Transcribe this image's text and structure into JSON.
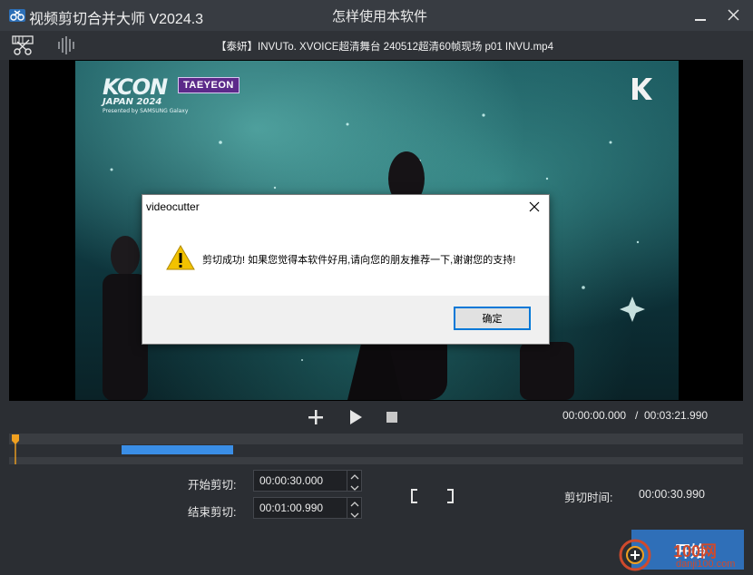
{
  "window": {
    "title": "视频剪切合并大师 V2024.3",
    "help_link": "怎样使用本软件"
  },
  "toolbar": {
    "file_name": "【泰妍】INVUTo. XVOICE超清舞台 240512超清60帧现场 p01 INVU.mp4",
    "icons": [
      "scissors-film-icon",
      "audio-wave-icon"
    ]
  },
  "video": {
    "overlay_logo": "KCON",
    "overlay_logo_sub": "JAPAN 2024",
    "overlay_logo_tiny": "Presented by SAMSUNG Galaxy",
    "overlay_artist": "TAEYEON"
  },
  "dialog": {
    "title": "videocutter",
    "message": "剪切成功! 如果您觉得本软件好用,请向您的朋友推荐一下,谢谢您的支持!",
    "ok_label": "确定"
  },
  "transport": {
    "current_time": "00:00:00.000",
    "separator": "/",
    "total_time": "00:03:21.990"
  },
  "timeline": {
    "playhead_fraction": 0.0,
    "selection_start_fraction": 0.1533,
    "selection_end_fraction": 0.3054
  },
  "cut": {
    "start_label": "开始剪切:",
    "start_value": "00:00:30.000",
    "end_label": "结束剪切:",
    "end_value": "00:01:00.990",
    "duration_label": "剪切时间:",
    "duration_value": "00:00:30.990"
  },
  "start_button": {
    "label": "开始"
  },
  "watermark": {
    "text": "100网",
    "url": "danji100.com"
  },
  "colors": {
    "accent": "#3a8ee6",
    "playhead": "#f0a020",
    "dialog_ok_border": "#0078d7",
    "warning": "#f2c200"
  }
}
